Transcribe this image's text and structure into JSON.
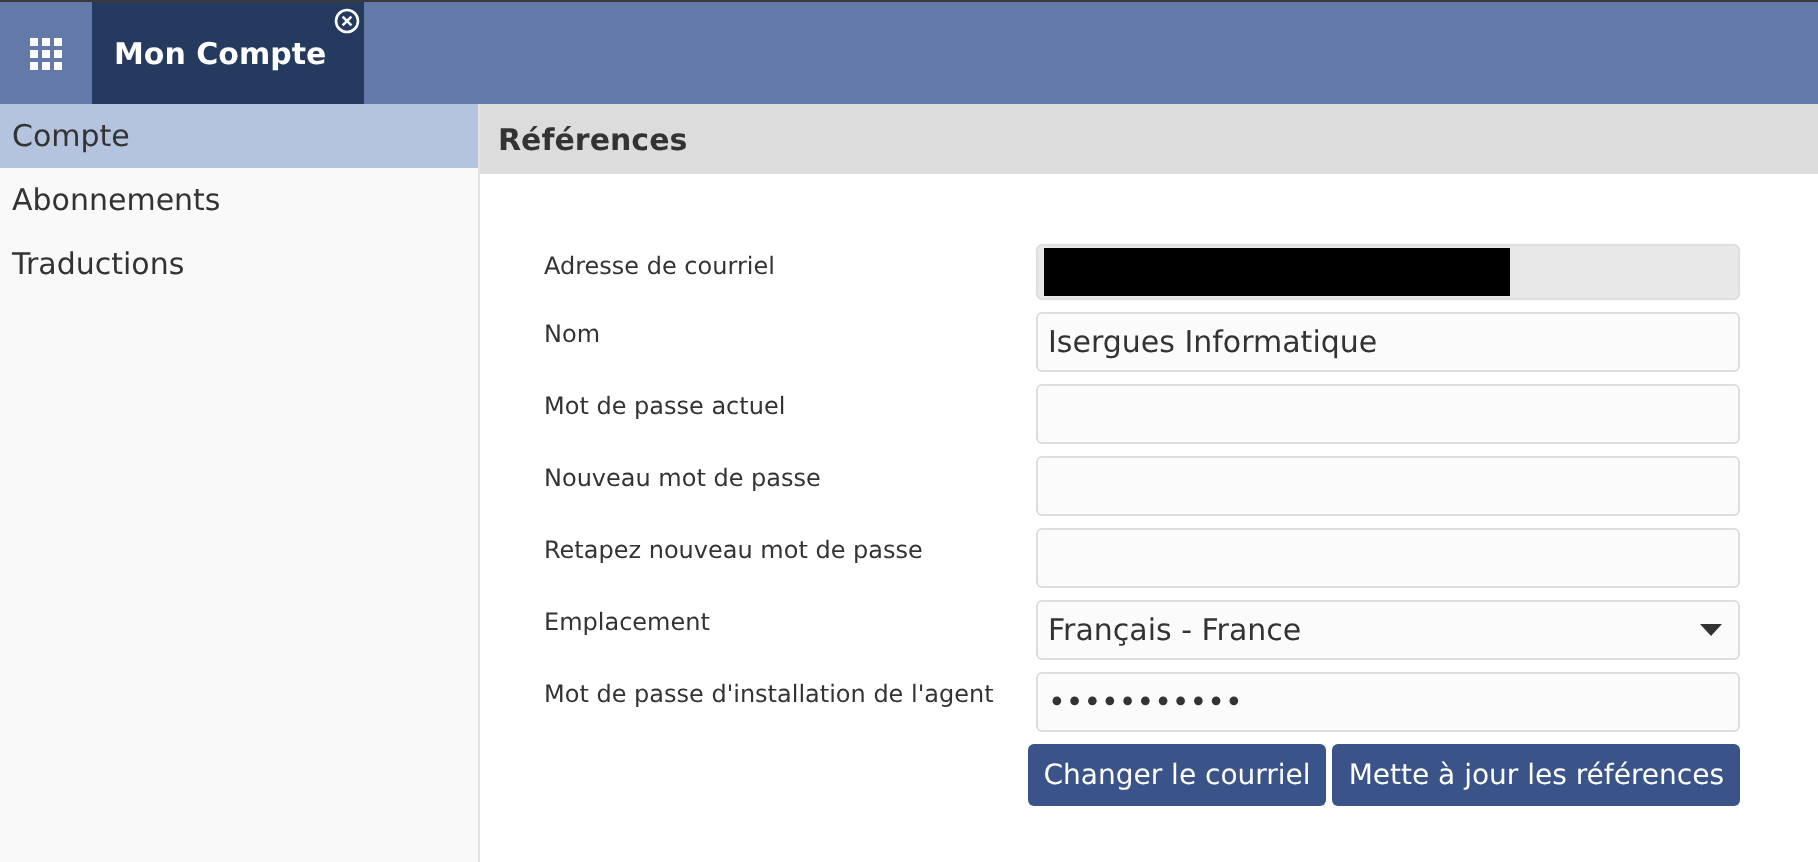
{
  "top_bar": {
    "tab": {
      "title": "Mon Compte",
      "selected": true
    }
  },
  "sidebar": {
    "items": [
      {
        "label": "Compte",
        "selected": true
      },
      {
        "label": "Abonnements",
        "selected": false
      },
      {
        "label": "Traductions",
        "selected": false
      }
    ]
  },
  "section": {
    "title": "Références"
  },
  "form": {
    "fields": [
      {
        "label": "Adresse de courriel",
        "kind": "readonly",
        "redacted": true
      },
      {
        "label": "Nom",
        "kind": "text",
        "value": "Isergues Informatique"
      },
      {
        "label": "Mot de passe actuel",
        "kind": "password"
      },
      {
        "label": "Nouveau mot de passe",
        "kind": "password"
      },
      {
        "label": "Retapez nouveau mot de passe",
        "kind": "password"
      },
      {
        "label": "Emplacement",
        "kind": "select",
        "value": "Français - France"
      },
      {
        "label": "Mot de passe d'installation de l'agent",
        "kind": "password",
        "value": "•••••••••••"
      }
    ]
  },
  "buttons": [
    "Changer le courriel",
    "Mette à jour les références"
  ]
}
